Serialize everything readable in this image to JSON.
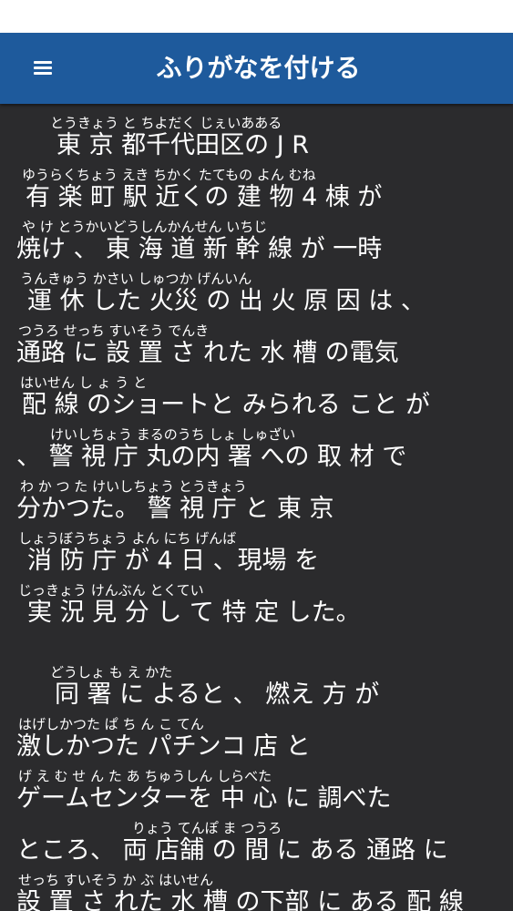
{
  "app_bar": {
    "title": "ふりがなを付ける",
    "menu_icon": "hamburger-menu-icon"
  },
  "article": {
    "lines": [
      {
        "ruby": "とうきょう と ちよだく じぇいあある",
        "text": "東 京 都千代田区の J R"
      },
      {
        "ruby": "ゆうらくちょう えき ちかく たてもの よん むね",
        "text": "有 楽 町 駅 近くの 建 物 4 棟 が"
      },
      {
        "ruby": "や け とうかいどうしんかんせん いちじ",
        "text": "焼け 、 東 海 道 新 幹 線 が 一時"
      },
      {
        "ruby": "うんきゅう かさい しゅつか げんいん",
        "text": "運 休 した 火災 の 出 火 原 因 は 、"
      },
      {
        "ruby": "つうろ せっち すいそう でんき",
        "text": "通路 に 設 置 さ れた 水 槽 の電気"
      },
      {
        "ruby": "はいせん し ょ う と",
        "text": "配 線 のショートと みられる こと が"
      },
      {
        "ruby": "けいしちょう まるのうち しょ しゅざい",
        "text": "、 警 視 庁 丸の内 署 への 取 材 で"
      },
      {
        "ruby": "わ か つ た けいしちょう とうきょう",
        "text": "分かつた。 警 視 庁 と 東 京"
      },
      {
        "ruby": "しょうぼうちょう よん にち げんば",
        "text": "消 防 庁 が 4 日 、現場 を"
      },
      {
        "ruby": "じっきょう けんぶん とくてい",
        "text": "実 況 見 分 し て 特 定 した。"
      },
      {
        "ruby": "どうしょ も え かた",
        "text": "同 署 に よると 、 燃え 方 が"
      },
      {
        "ruby": "はげしかつた ぱ ち ん こ てん",
        "text": "激しかつた パチンコ 店 と"
      },
      {
        "ruby": "げ え む せ ん た あ ちゅうしん しらべた",
        "text": "ゲームセンターを 中 心 に 調べた"
      },
      {
        "ruby": "りょう てんぽ ま つうろ",
        "text": "ところ、 両 店舗 の 間 に ある 通路 に"
      },
      {
        "ruby": "せっち すいそう か ぶ はいせん",
        "text": "設 置 さ れた 水 槽 の下部 に ある 配 線"
      }
    ]
  }
}
